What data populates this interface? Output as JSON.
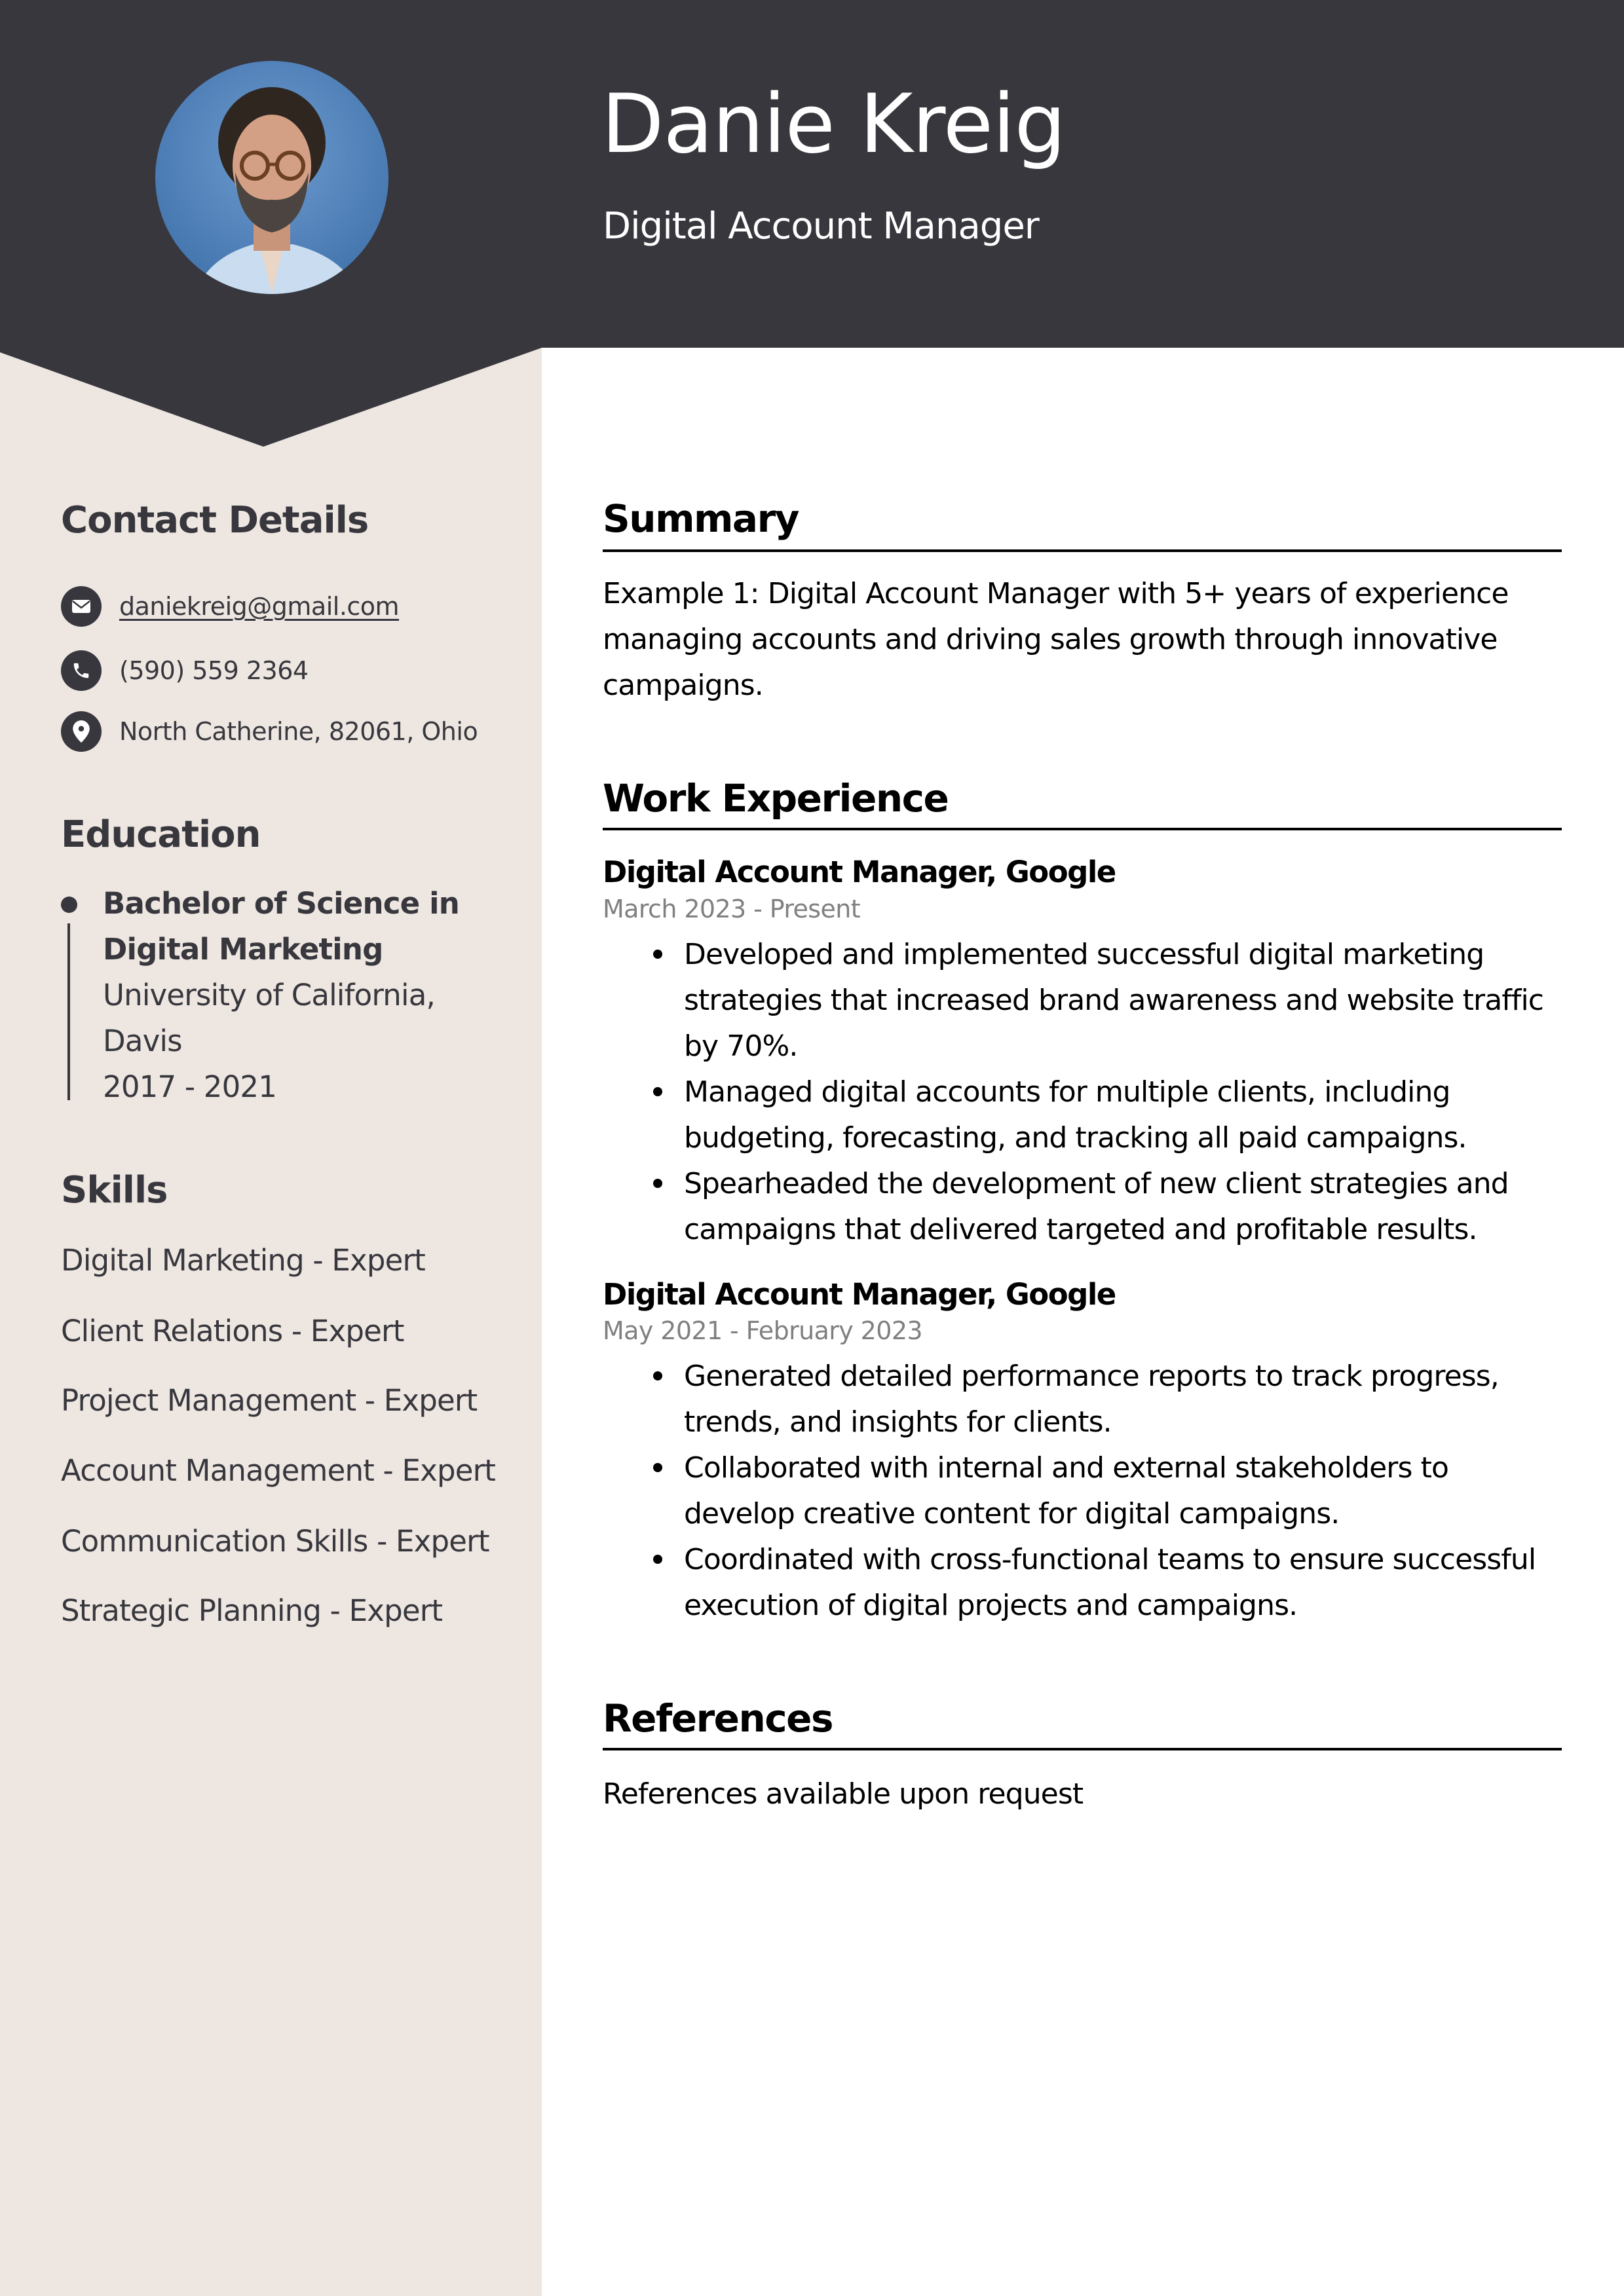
{
  "colors": {
    "header_bg": "#37373d",
    "sidebar_bg": "#ede6e1",
    "sidebar_text": "#37373d",
    "main_text": "#000000",
    "date_text": "#808080"
  },
  "header": {
    "name": "Danie Kreig",
    "job_title": "Digital Account Manager",
    "photo_alt": "Profile photo of Danie Kreig"
  },
  "sidebar": {
    "contact": {
      "title": "Contact Details",
      "items": [
        {
          "icon": "envelope-icon",
          "text": "daniekreig@gmail.com",
          "is_link": true
        },
        {
          "icon": "phone-icon",
          "text": "(590) 559 2364"
        },
        {
          "icon": "location-pin-icon",
          "text": "North Catherine, 82061, Ohio"
        }
      ]
    },
    "education": {
      "title": "Education",
      "entries": [
        {
          "degree_line1": "Bachelor of Science in",
          "degree_line2": "Digital Marketing",
          "school_line1": "University of California,",
          "school_line2": "Davis",
          "years": "2017 - 2021"
        }
      ]
    },
    "skills": {
      "title": "Skills",
      "items": [
        "Digital Marketing - Expert",
        "Client Relations - Expert",
        "Project Management - Expert",
        "Account Management - Expert",
        "Communication Skills - Expert",
        "Strategic Planning - Expert"
      ]
    }
  },
  "main": {
    "summary": {
      "title": "Summary",
      "lines": [
        "Example 1: Digital Account Manager with 5+ years of experience",
        "managing accounts and driving sales growth through innovative",
        "campaigns."
      ]
    },
    "work_experience": {
      "title": "Work Experience",
      "jobs": [
        {
          "heading": "Digital Account Manager, Google",
          "dates": "March 2023 - Present",
          "bullets": [
            "Developed and implemented successful digital marketing strategies that increased brand awareness and website traffic by 70%.",
            "Managed digital accounts for multiple clients, including budgeting, forecasting, and tracking all paid campaigns.",
            "Spearheaded the development of new client strategies and campaigns that delivered targeted and profitable results."
          ]
        },
        {
          "heading": "Digital Account Manager, Google",
          "dates": "May 2021 - February 2023",
          "bullets": [
            "Generated detailed performance reports to track progress, trends, and insights for clients.",
            "Collaborated with internal and external stakeholders to develop creative content for digital campaigns.",
            "Coordinated with cross-functional teams to ensure successful execution of digital projects and campaigns."
          ]
        }
      ]
    },
    "references": {
      "title": "References",
      "text": "References available upon request"
    }
  }
}
